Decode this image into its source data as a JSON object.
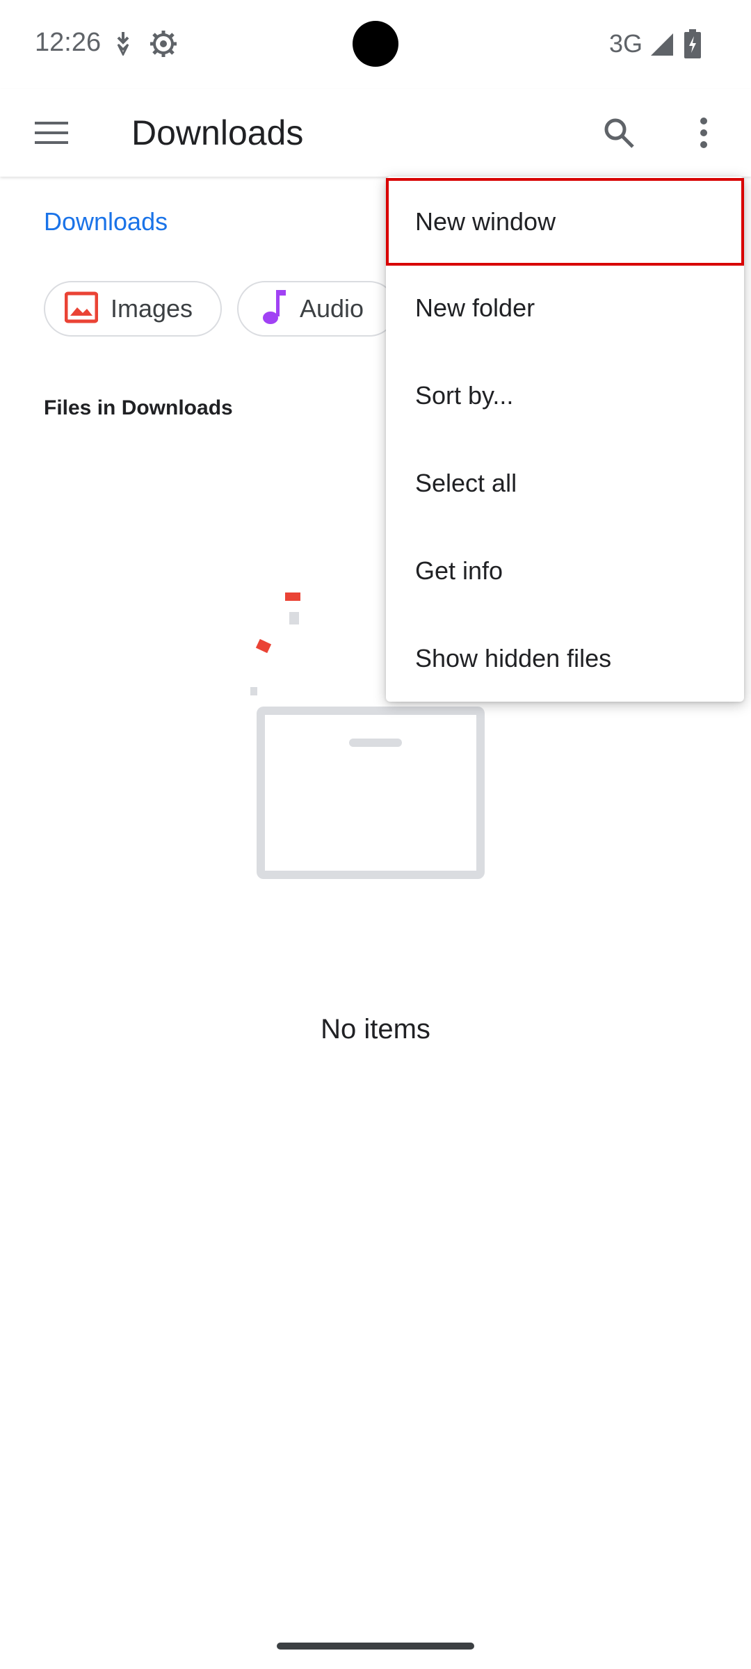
{
  "status_bar": {
    "time": "12:26",
    "network": "3G",
    "icons": [
      "download-status-icon",
      "settings-status-icon",
      "signal-icon",
      "battery-charging-icon"
    ]
  },
  "app_bar": {
    "title": "Downloads",
    "icons": [
      "menu-icon",
      "search-icon",
      "more-vert-icon"
    ]
  },
  "breadcrumb": "Downloads",
  "chips": [
    {
      "label": "Images",
      "icon": "image-icon",
      "color": "#ea4335"
    },
    {
      "label": "Audio",
      "icon": "music-note-icon",
      "color": "#a142f4"
    }
  ],
  "section_label": "Files in Downloads",
  "empty_state": {
    "text": "No items",
    "accent_color": "#ea4335"
  },
  "menu": {
    "items": [
      {
        "label": "New window",
        "highlighted": true
      },
      {
        "label": "New folder"
      },
      {
        "label": "Sort by..."
      },
      {
        "label": "Select all"
      },
      {
        "label": "Get info"
      },
      {
        "label": "Show hidden files"
      }
    ],
    "highlight_color": "#d80000"
  }
}
